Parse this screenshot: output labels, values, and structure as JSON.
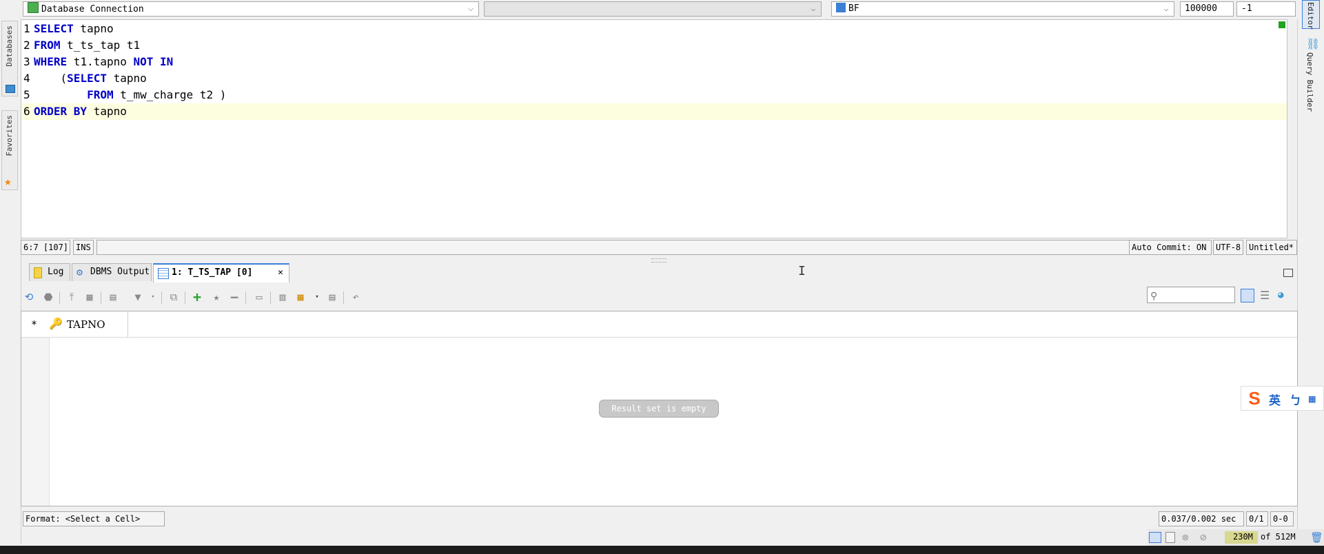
{
  "toolbar": {
    "connection": "Database Connection",
    "schema": "",
    "user": "BF",
    "max_rows": "100000",
    "fetch": "-1"
  },
  "left_tabs": {
    "databases": "Databases",
    "favorites": "Favorites"
  },
  "right_tabs": {
    "editor": "Editor",
    "query_builder": "Query Builder"
  },
  "editor": {
    "lines": [
      {
        "num": "1",
        "parts": [
          {
            "t": "SELECT",
            "k": true
          },
          {
            "t": " tapno",
            "k": false
          }
        ]
      },
      {
        "num": "2",
        "parts": [
          {
            "t": "FROM",
            "k": true
          },
          {
            "t": " t_ts_tap t1",
            "k": false
          }
        ]
      },
      {
        "num": "3",
        "parts": [
          {
            "t": "WHERE",
            "k": true
          },
          {
            "t": " t1.tapno ",
            "k": false
          },
          {
            "t": "NOT IN",
            "k": true
          }
        ]
      },
      {
        "num": "4",
        "parts": [
          {
            "t": "    (",
            "k": false
          },
          {
            "t": "SELECT",
            "k": true
          },
          {
            "t": " tapno",
            "k": false
          }
        ]
      },
      {
        "num": "5",
        "parts": [
          {
            "t": "        ",
            "k": false
          },
          {
            "t": "FROM",
            "k": true
          },
          {
            "t": " t_mw_charge t2 )",
            "k": false
          }
        ]
      },
      {
        "num": "6",
        "parts": [
          {
            "t": "ORDER BY",
            "k": true
          },
          {
            "t": " tapno",
            "k": false
          }
        ]
      }
    ]
  },
  "editor_status": {
    "position": "6:7 [107]",
    "mode": "INS",
    "auto_commit": "Auto Commit: ON",
    "encoding": "UTF-8",
    "doc": "Untitled*"
  },
  "output_tabs": {
    "log": "Log",
    "dbms": "DBMS Output",
    "result": "1: T_TS_TAP [0]",
    "close": "✕"
  },
  "grid": {
    "row_marker": "*",
    "column": "TAPNO",
    "empty_message": "Result set is empty"
  },
  "bottom_status": {
    "format": "Format:  <Select  a  Cell>",
    "timing": "0.037/0.002 sec",
    "rows": "0/1",
    "sel": "0-0"
  },
  "memory": {
    "used": "230M",
    "of": "of 512M"
  },
  "ime": {
    "lang": "英",
    "punct": "ㄅ"
  },
  "colors": {
    "keyword": "#0000c8",
    "accent": "#3b7fd6",
    "current_line": "#fdfde0",
    "ime": "#ff5a14"
  }
}
